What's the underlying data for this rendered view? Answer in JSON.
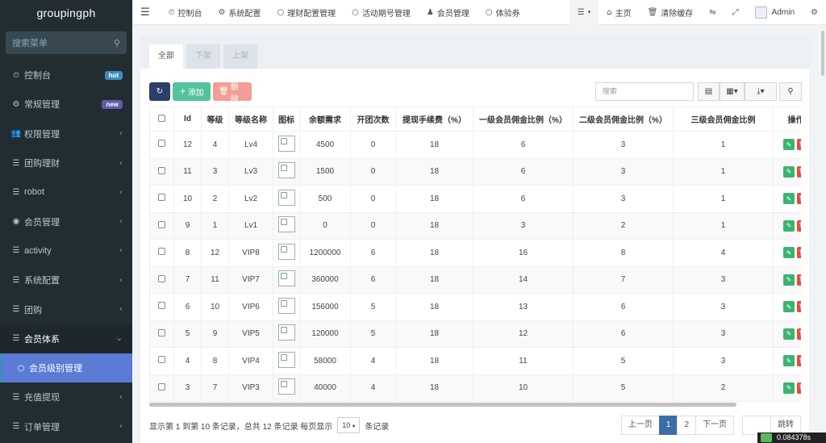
{
  "brand": "groupingph",
  "sidebar": {
    "search_placeholder": "搜索菜单",
    "items": [
      {
        "icon": "dashboard-icon",
        "glyph": "⏲",
        "label": "控制台",
        "badge": "hot"
      },
      {
        "icon": "cogs-icon",
        "glyph": "⚙",
        "label": "常规管理",
        "badge": "new"
      },
      {
        "icon": "group-icon",
        "glyph": "👥",
        "label": "权限管理",
        "chev": "‹"
      },
      {
        "icon": "list-icon",
        "glyph": "☰",
        "label": "团购理财",
        "chev": "‹"
      },
      {
        "icon": "list-icon",
        "glyph": "☰",
        "label": "robot",
        "chev": "‹"
      },
      {
        "icon": "user-circle-icon",
        "glyph": "◉",
        "label": "会员管理",
        "chev": "‹"
      },
      {
        "icon": "list-icon",
        "glyph": "☰",
        "label": "activity",
        "chev": "‹"
      },
      {
        "icon": "list-icon",
        "glyph": "☰",
        "label": "系统配置",
        "chev": "‹"
      },
      {
        "icon": "list-icon",
        "glyph": "☰",
        "label": "团购",
        "chev": "‹"
      },
      {
        "icon": "list-icon",
        "glyph": "☰",
        "label": "会员体系",
        "chev": "⌄"
      },
      {
        "icon": "circle-icon",
        "glyph": "○",
        "label": "会员级别管理",
        "chev": ""
      },
      {
        "icon": "list-icon",
        "glyph": "☰",
        "label": "充值提现",
        "chev": "‹"
      },
      {
        "icon": "list-icon",
        "glyph": "☰",
        "label": "订单管理",
        "chev": "‹"
      }
    ]
  },
  "topnav": {
    "items": [
      {
        "glyph": "⏲",
        "label": "控制台"
      },
      {
        "glyph": "⚙",
        "label": "系统配置"
      },
      {
        "glyph": "○",
        "label": "理财配置管理"
      },
      {
        "glyph": "○",
        "label": "活动期号管理"
      },
      {
        "glyph": "♟",
        "label": "会员管理"
      },
      {
        "glyph": "○",
        "label": "体验券"
      }
    ],
    "home": "主页",
    "clear_cache": "清除缓存",
    "user": "Admin"
  },
  "tabs": [
    "全部",
    "下架",
    "上架"
  ],
  "toolbar": {
    "add": "添加",
    "delete": "删除",
    "search_placeholder": "搜索"
  },
  "table": {
    "columns": [
      "Id",
      "等级",
      "等级名称",
      "图标",
      "余额需求",
      "开团次数",
      "提现手续费（%）",
      "一级会员佣金比例（%）",
      "二级会员佣金比例（%）",
      "三级会员佣金比例",
      "操作"
    ],
    "rows": [
      [
        "12",
        "4",
        "Lv4",
        "4500",
        "0",
        "18",
        "6",
        "3",
        "1"
      ],
      [
        "11",
        "3",
        "Lv3",
        "1500",
        "0",
        "18",
        "6",
        "3",
        "1"
      ],
      [
        "10",
        "2",
        "Lv2",
        "500",
        "0",
        "18",
        "6",
        "3",
        "1"
      ],
      [
        "9",
        "1",
        "Lv1",
        "0",
        "0",
        "18",
        "3",
        "2",
        "1"
      ],
      [
        "8",
        "12",
        "VIP8",
        "1200000",
        "6",
        "18",
        "16",
        "8",
        "4"
      ],
      [
        "7",
        "11",
        "VIP7",
        "360000",
        "6",
        "18",
        "14",
        "7",
        "3"
      ],
      [
        "6",
        "10",
        "VIP6",
        "156000",
        "5",
        "18",
        "13",
        "6",
        "3"
      ],
      [
        "5",
        "9",
        "VIP5",
        "120000",
        "5",
        "18",
        "12",
        "6",
        "3"
      ],
      [
        "4",
        "8",
        "VIP4",
        "58000",
        "4",
        "18",
        "11",
        "5",
        "3"
      ],
      [
        "3",
        "7",
        "VIP3",
        "40000",
        "4",
        "18",
        "10",
        "5",
        "2"
      ]
    ]
  },
  "footer": {
    "summary": "显示第 1 到第 10 条记录，总共 12 条记录 每页显示",
    "page_size": "10",
    "suffix": "条记录",
    "prev": "上一页",
    "pages": [
      "1",
      "2"
    ],
    "next": "下一页",
    "jump": "跳转"
  },
  "timer": "0.084378s"
}
